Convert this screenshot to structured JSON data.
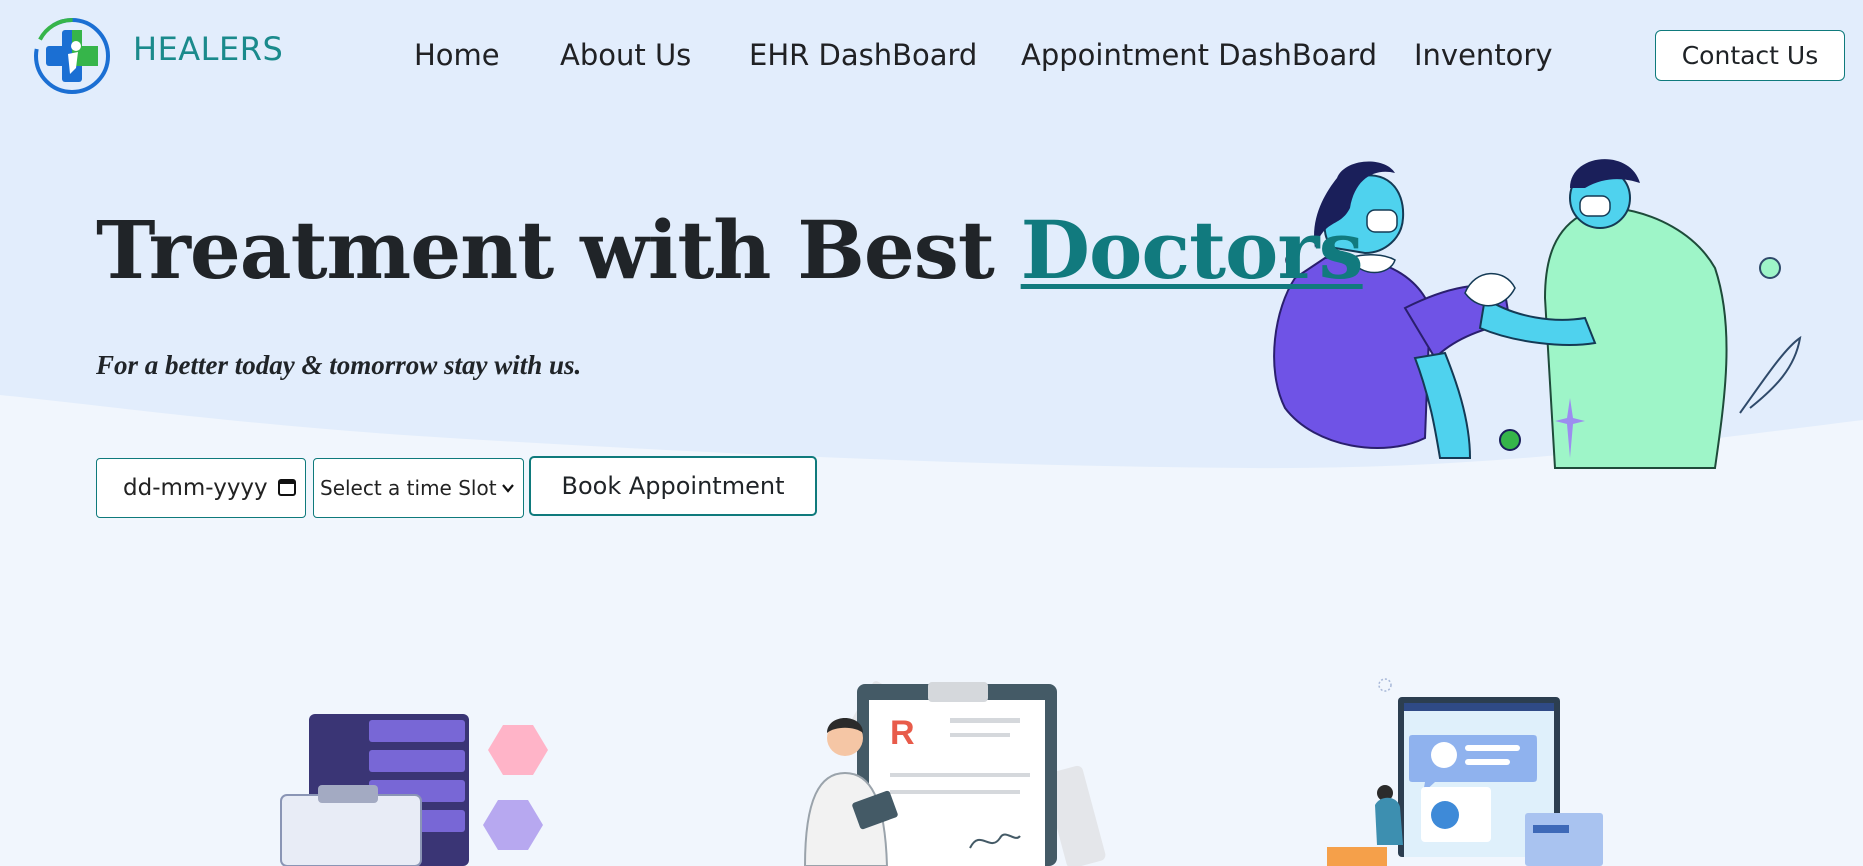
{
  "brand": {
    "name": "HEALERS",
    "logo_icon": "medical-cross-logo-icon"
  },
  "nav": {
    "items": [
      {
        "label": "Home"
      },
      {
        "label": "About Us"
      },
      {
        "label": "EHR DashBoard"
      },
      {
        "label": "Appointment DashBoard"
      },
      {
        "label": "Inventory"
      }
    ],
    "contact_label": "Contact Us"
  },
  "hero": {
    "title_main": "Treatment with Best ",
    "title_accent": "Doctors",
    "subtitle": "For a better today & tomorrow stay with us."
  },
  "booking": {
    "date_placeholder": "dd-mm-yyyy",
    "date_icon": "calendar-icon",
    "time_select_value": "Select a time Slot",
    "select_icon": "chevron-down-icon",
    "book_label": "Book Appointment"
  },
  "illustrations": {
    "hero": "nurse-vaccinating-patient-illustration",
    "features": [
      "medical-records-server-illustration",
      "doctor-prescription-illustration",
      "online-consultation-screen-illustration"
    ]
  },
  "colors": {
    "accent": "#117a7e",
    "brand_teal": "#1a8a8c",
    "hero_bg": "#e2edfc",
    "page_bg": "#f1f6fd",
    "logo_blue": "#1b6fd3",
    "logo_green": "#36b54a"
  }
}
